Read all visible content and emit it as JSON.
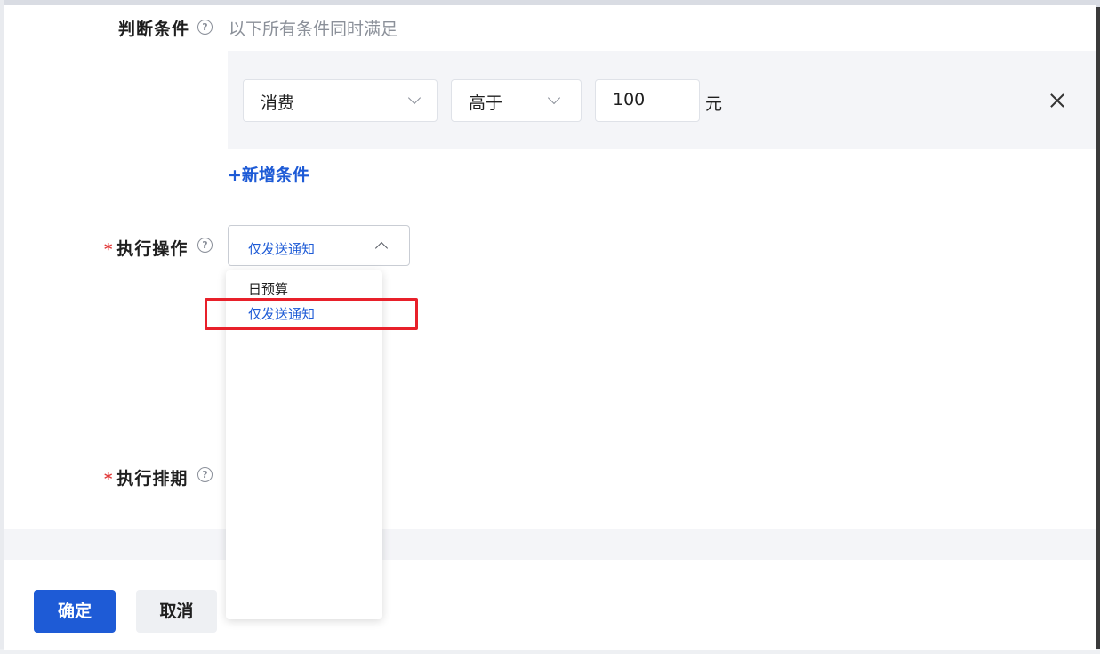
{
  "form": {
    "condition": {
      "label": "判断条件",
      "hint": "以下所有条件同时满足",
      "metric": "消费",
      "operator": "高于",
      "value": "100",
      "unit": "元",
      "add_condition": "+新增条件"
    },
    "action": {
      "label": "执行操作",
      "required_mark": "*",
      "selected": "仅发送通知",
      "options": [
        "日预算",
        "仅发送通知"
      ]
    },
    "schedule": {
      "label": "执行排期",
      "required_mark": "*"
    }
  },
  "buttons": {
    "confirm": "确定",
    "cancel": "取消"
  },
  "icons": {
    "help": "question-circle-icon",
    "dropdown": "chevron-down-icon",
    "dropdown_open": "chevron-up-icon",
    "remove": "close-icon"
  },
  "colors": {
    "primary": "#1e5bd6",
    "required": "#e23b3b",
    "highlight_box": "#e8202a",
    "panel_bg": "#f4f5f8"
  }
}
